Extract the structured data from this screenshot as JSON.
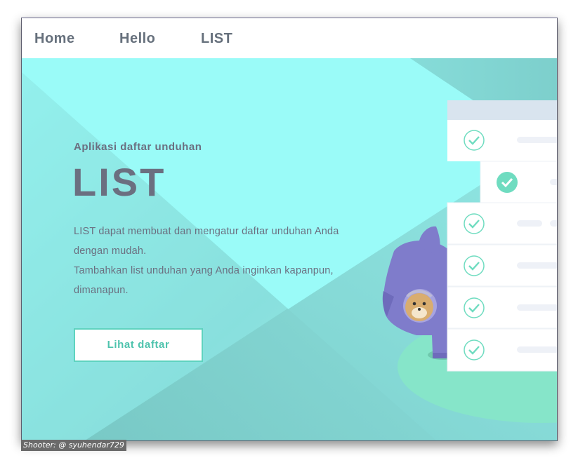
{
  "navbar": {
    "items": [
      {
        "label": "Home"
      },
      {
        "label": "Hello"
      },
      {
        "label": "LIST"
      }
    ]
  },
  "hero": {
    "subtitle": "Aplikasi daftar unduhan",
    "title": "LIST",
    "description": [
      "LIST dapat membuat dan mengatur daftar unduhan Anda",
      "dengan mudah.",
      "Tambahkan list unduhan yang Anda inginkan kapanpun,",
      "dimanapun."
    ],
    "cta_label": "Lihat daftar",
    "illustration": {
      "list_rows": 6,
      "icons": [
        "check-circle-icon",
        "check-circle-filled-icon"
      ]
    }
  },
  "watermark": "Shooter: @ syuhendar729",
  "colors": {
    "hero_bg": "#9afbf8",
    "accent": "#5fd3bf",
    "text": "#6b6f80",
    "nav_text": "#66707c",
    "mascot": "#7f7ccb"
  }
}
